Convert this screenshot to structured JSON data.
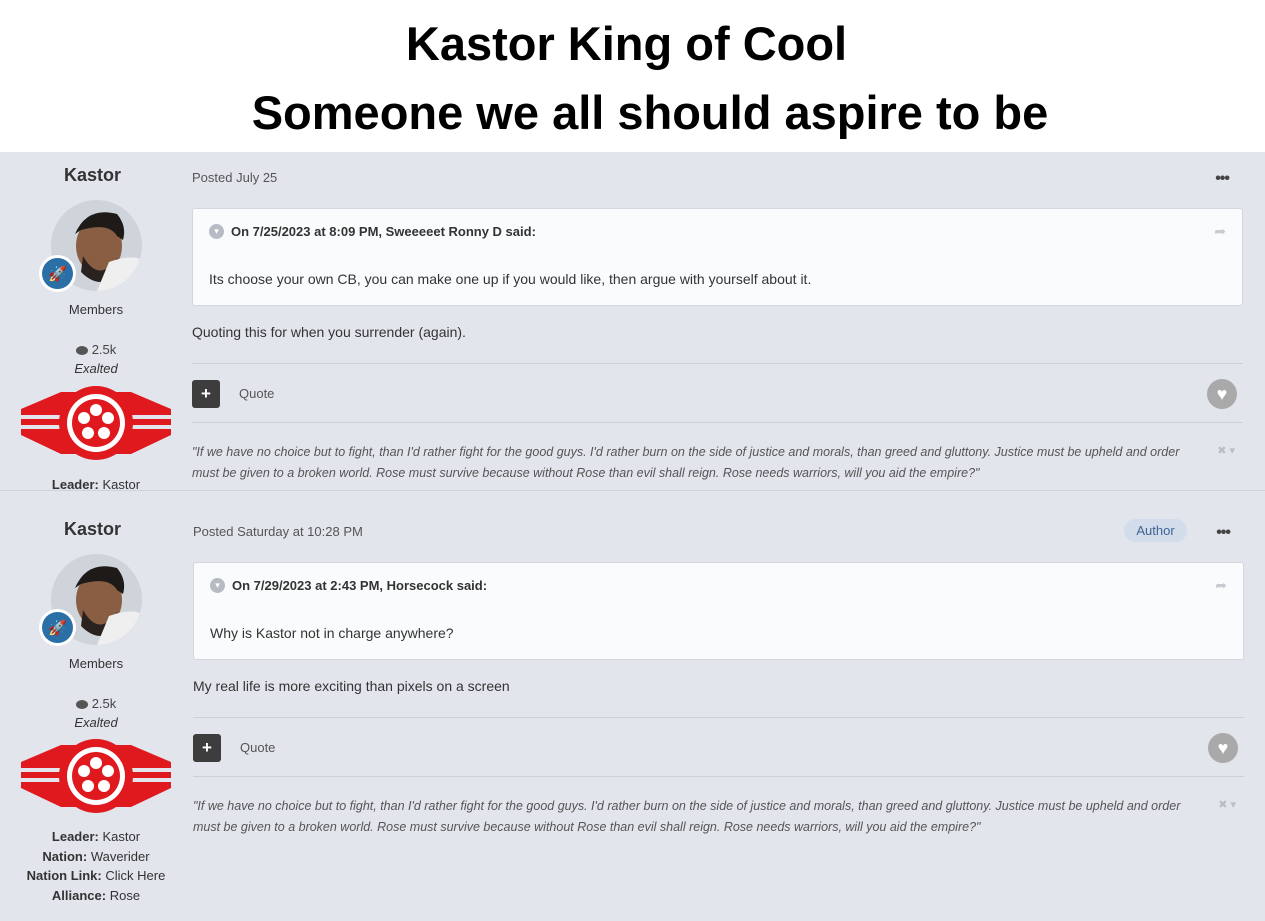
{
  "caption": {
    "line1": "Kastor King of Cool",
    "line2": "Someone we all should aspire to be"
  },
  "posts": [
    {
      "author": "Kastor",
      "group": "Members",
      "post_count": "2.5k",
      "rank": "Exalted",
      "fields": [
        {
          "label": "Leader:",
          "value": "Kastor"
        }
      ],
      "posted": "Posted July 25",
      "author_tag": "",
      "quote_header": "On 7/25/2023 at 8:09 PM, Sweeeeet Ronny D said:",
      "quote_text": "Its choose your own CB, you can make one up if you would like, then argue with yourself about it.",
      "reply": "Quoting this for when you surrender (again).",
      "quote_button": "Quote",
      "signature": "\"If we have no choice but to fight, than I'd rather fight for the good guys. I'd rather burn on the side of justice and morals, than greed and gluttony. Justice must be upheld and order must be given to a broken world. Rose must survive because without Rose than evil shall reign. Rose needs warriors, will you aid the empire?\""
    },
    {
      "author": "Kastor",
      "group": "Members",
      "post_count": "2.5k",
      "rank": "Exalted",
      "fields": [
        {
          "label": "Leader:",
          "value": "Kastor"
        },
        {
          "label": "Nation:",
          "value": "Waverider"
        },
        {
          "label": "Nation Link:",
          "value": "Click Here"
        },
        {
          "label": "Alliance:",
          "value": "Rose"
        }
      ],
      "posted": "Posted Saturday at 10:28 PM",
      "author_tag": "Author",
      "quote_header": "On 7/29/2023 at 2:43 PM, Horsecock said:",
      "quote_text": "Why is Kastor not in charge anywhere?",
      "reply": "My real life is more exciting than pixels on a screen",
      "quote_button": "Quote",
      "signature": "\"If we have no choice but to fight, than I'd rather fight for the good guys. I'd rather burn on the side of justice and morals, than greed and gluttony. Justice must be upheld and order must be given to a broken world. Rose must survive because without Rose than evil shall reign. Rose needs warriors, will you aid the empire?\""
    }
  ],
  "icons": {
    "more": "more-horizontal-icon",
    "badge": "rocket-icon",
    "chevron": "chevron-down-icon",
    "share": "share-icon",
    "like": "heart-icon",
    "post_count": "speech-bubble-icon"
  },
  "colors": {
    "forum_bg": "#e2e5ec",
    "badge_blue": "#2a6fa6",
    "flag_red": "#e0191f",
    "author_tag_bg": "#d3dcea"
  }
}
